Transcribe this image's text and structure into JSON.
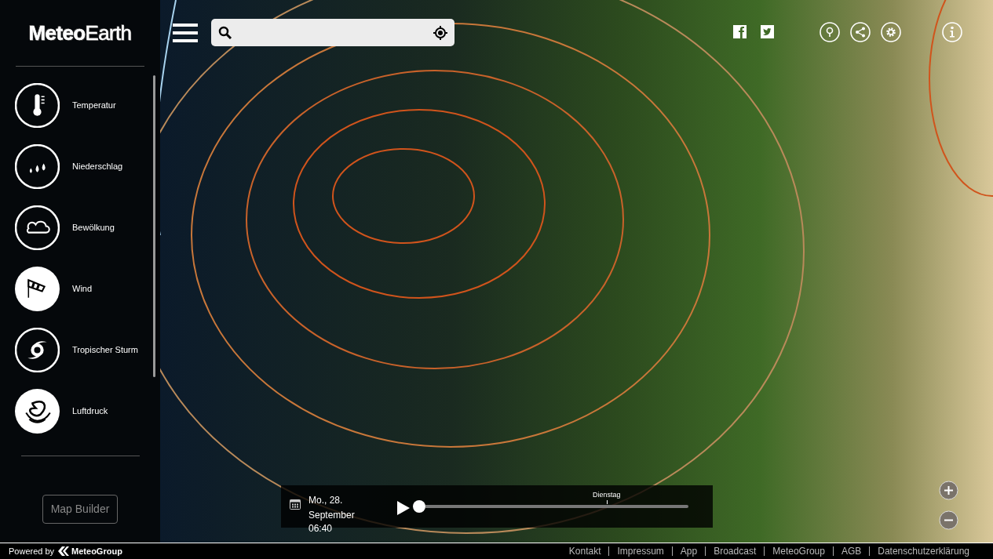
{
  "logo": "**Meteo**Earth",
  "sidebar": {
    "items": [
      {
        "label": "Temperatur",
        "kind": "thermometer",
        "selected": false
      },
      {
        "label": "Niederschlag",
        "kind": "rain",
        "selected": false
      },
      {
        "label": "Bewölkung",
        "kind": "cloud",
        "selected": false
      },
      {
        "label": "Wind",
        "kind": "windsock",
        "selected": true
      },
      {
        "label": "Tropischer Sturm",
        "kind": "storm",
        "selected": false
      },
      {
        "label": "Luftdruck",
        "kind": "pressure",
        "selected": true
      }
    ],
    "button": "Map Builder"
  },
  "timeline": {
    "date_line_1": "Mo., 28.",
    "date_line_2": "September",
    "time": "06:40",
    "day_marker": "Dienstag",
    "level": 0
  },
  "footer": {
    "powered_by": "Powered by",
    "brand": "MeteoGroup",
    "links": [
      "Kontakt",
      "Impressum",
      "App",
      "Broadcast",
      "MeteoGroup",
      "AGB",
      "Datenschutzerklärung"
    ]
  }
}
